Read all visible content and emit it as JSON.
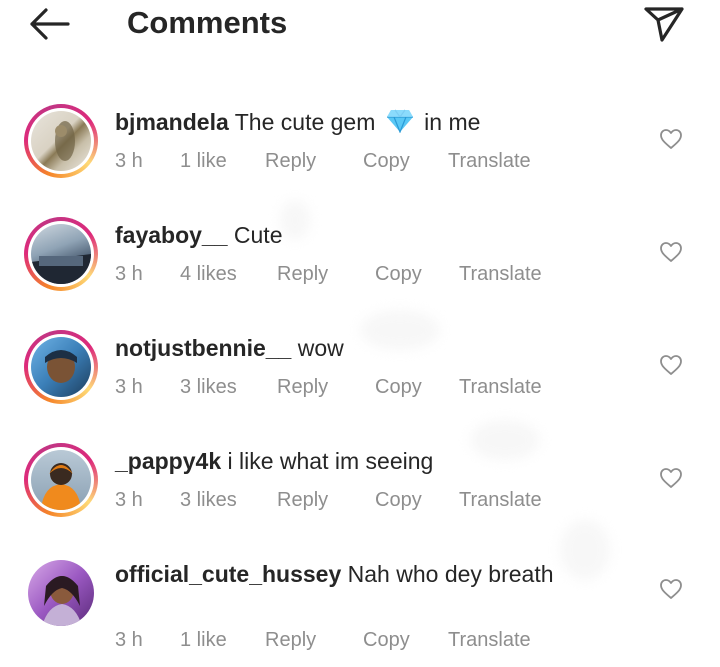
{
  "header": {
    "title": "Comments",
    "back_icon": "arrow-left-icon",
    "send_icon": "paper-plane-icon"
  },
  "comments": [
    {
      "username": "bjmandela",
      "text_before": "The cute gem",
      "emoji": "gem-stone-emoji",
      "text_after": "in me",
      "time": "3 h",
      "likes": "1 like",
      "reply": "Reply",
      "copy": "Copy",
      "translate": "Translate"
    },
    {
      "username": "fayaboy__",
      "text": "Cute",
      "time": "3 h",
      "likes": "4 likes",
      "reply": "Reply",
      "copy": "Copy",
      "translate": "Translate"
    },
    {
      "username": "notjustbennie__",
      "text": "wow",
      "time": "3 h",
      "likes": "3 likes",
      "reply": "Reply",
      "copy": "Copy",
      "translate": "Translate"
    },
    {
      "username": "_pappy4k",
      "text": "i like what im seeing",
      "time": "3 h",
      "likes": "3 likes",
      "reply": "Reply",
      "copy": "Copy",
      "translate": "Translate"
    },
    {
      "username": "official_cute_hussey",
      "text": "Nah who dey breath",
      "time": "3 h",
      "likes": "1 like",
      "reply": "Reply",
      "copy": "Copy",
      "translate": "Translate"
    }
  ],
  "colors": {
    "text": "#262626",
    "meta": "#8e8e8e",
    "story_ring_start": "#f58529",
    "story_ring_end": "#dd2a7b"
  }
}
